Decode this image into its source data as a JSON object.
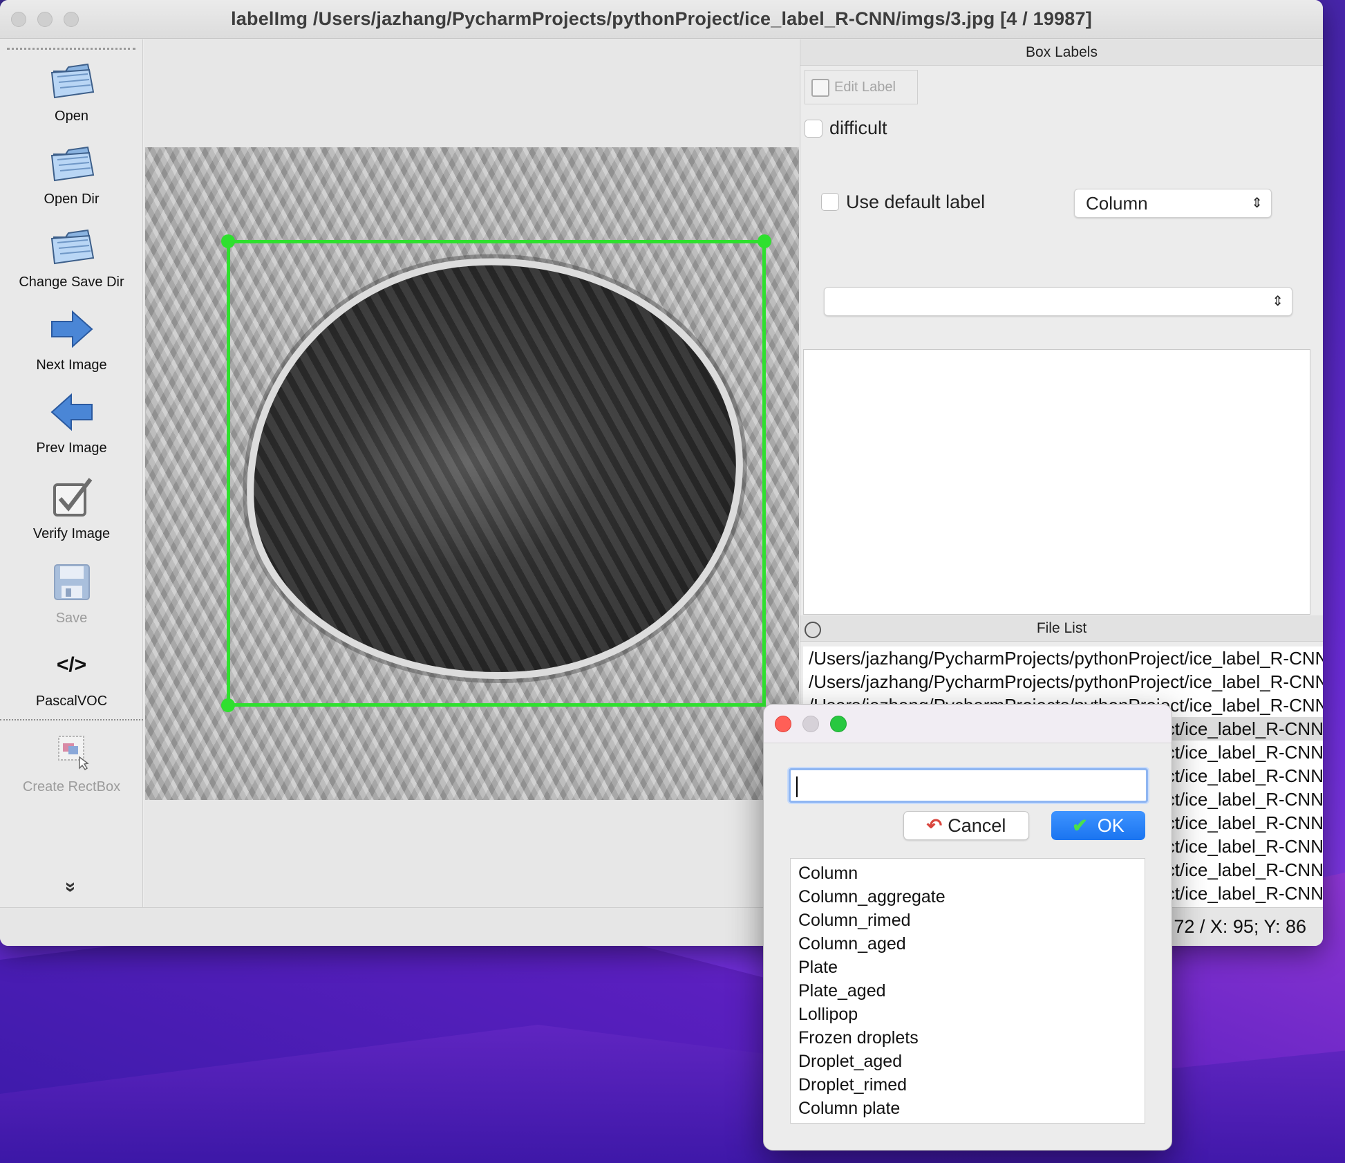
{
  "window": {
    "title": "labelImg /Users/jazhang/PycharmProjects/pythonProject/ice_label_R-CNN/imgs/3.jpg [4 / 19987]"
  },
  "toolbar": {
    "items": [
      {
        "label": "Open",
        "icon": "folder-open-icon",
        "enabled": true
      },
      {
        "label": "Open Dir",
        "icon": "folder-open-icon",
        "enabled": true
      },
      {
        "label": "Change Save Dir",
        "icon": "folder-open-icon",
        "enabled": true
      },
      {
        "label": "Next Image",
        "icon": "arrow-right-icon",
        "enabled": true
      },
      {
        "label": "Prev Image",
        "icon": "arrow-left-icon",
        "enabled": true
      },
      {
        "label": "Verify Image",
        "icon": "checkbox-icon",
        "enabled": true
      },
      {
        "label": "Save",
        "icon": "floppy-disk-icon",
        "enabled": false
      },
      {
        "label": "PascalVOC",
        "icon": "code-tag-icon",
        "enabled": true
      },
      {
        "label": "Create RectBox",
        "icon": "rect-box-icon",
        "enabled": false
      }
    ],
    "code_glyph": "</>",
    "more_glyph": "»"
  },
  "box_labels": {
    "title": "Box Labels",
    "edit_label": "Edit Label",
    "difficult": "difficult",
    "use_default_label": "Use default label",
    "default_label_value": "Column",
    "second_select_value": ""
  },
  "file_list": {
    "title": "File List",
    "rows": [
      "/Users/jazhang/PycharmProjects/pythonProject/ice_label_R-CNN",
      "/Users/jazhang/PycharmProjects/pythonProject/ice_label_R-CNN",
      "/Users/jazhang/PycharmProjects/pythonProject/ice_label_R-CNN",
      "ct/ice_label_R-CNN",
      "ct/ice_label_R-CNN",
      "ct/ice_label_R-CNN",
      "ct/ice_label_R-CNN",
      "ct/ice_label_R-CNN",
      "ct/ice_label_R-CNN",
      "ct/ice_label_R-CNN",
      "ct/ice_label_R-CNN"
    ],
    "selected_index": 3
  },
  "status": {
    "text": "72 / X: 95; Y: 86"
  },
  "dialog": {
    "input_value": "",
    "cancel_label": "Cancel",
    "ok_label": "OK",
    "labels": [
      "Column",
      "Column_aggregate",
      "Column_rimed",
      "Column_aged",
      "Plate",
      "Plate_aged",
      "Lollipop",
      "Frozen droplets",
      "Droplet_aged",
      "Droplet_rimed",
      "Column plate"
    ]
  },
  "colors": {
    "bbox": "#2fe02f",
    "ok_button": "#1a74f0",
    "close_dot": "#ff5f57",
    "zoom_dot": "#28c840"
  }
}
